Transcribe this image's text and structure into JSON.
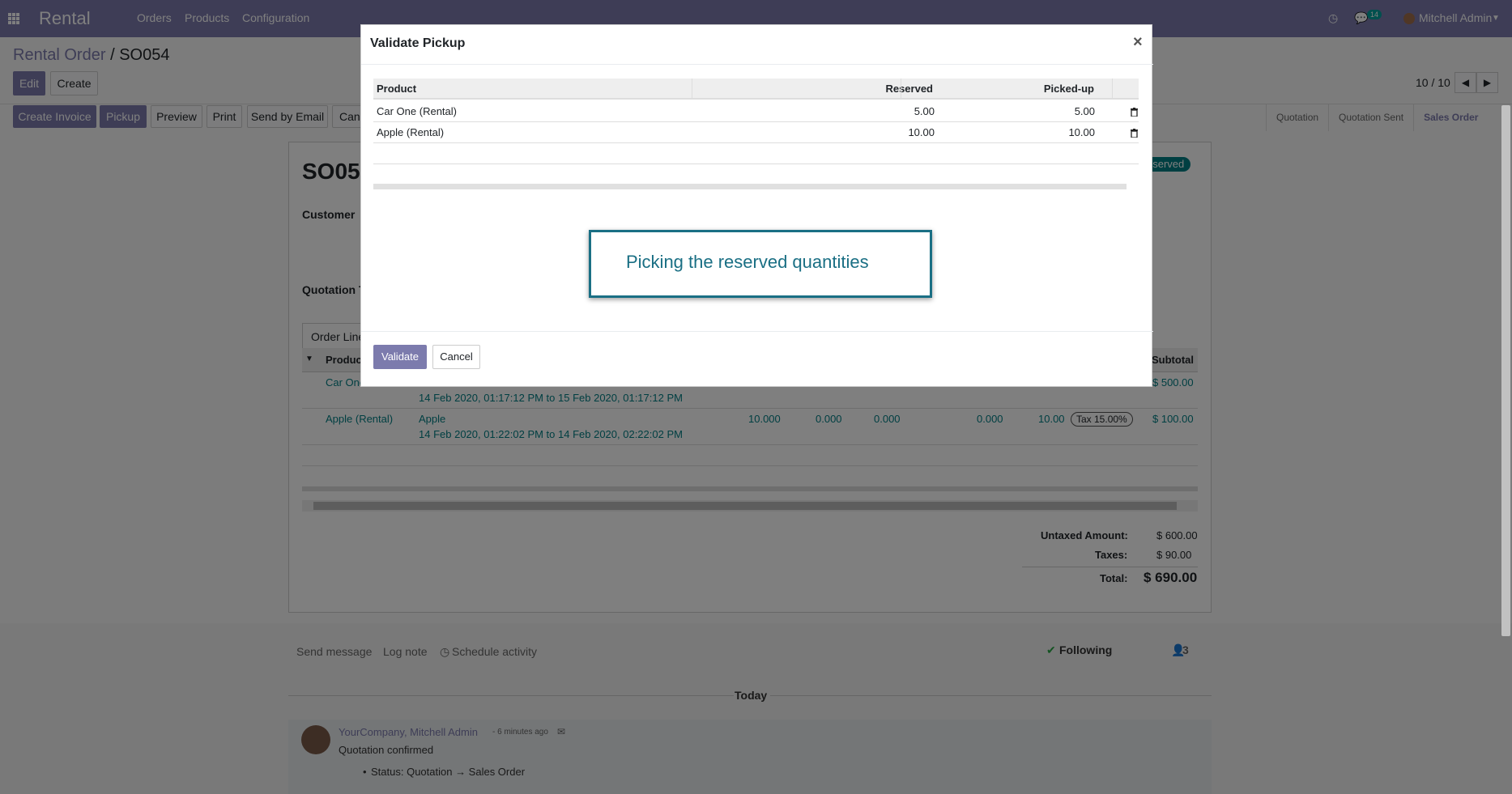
{
  "navbar": {
    "brand": "Rental",
    "menus": [
      "Orders",
      "Products",
      "Configuration"
    ],
    "notification_count": "14",
    "user": "Mitchell Admin"
  },
  "breadcrumb": {
    "parent": "Rental Order",
    "separator": "/",
    "current": "SO054"
  },
  "actions": {
    "edit": "Edit",
    "create": "Create"
  },
  "pager": {
    "text": "10 / 10"
  },
  "toolbar": {
    "create_invoice": "Create Invoice",
    "pickup": "Pickup",
    "preview": "Preview",
    "print": "Print",
    "send_email": "Send by Email",
    "cancel_partial": "Can"
  },
  "status_steps": [
    "Quotation",
    "Quotation Sent",
    "Sales Order"
  ],
  "form": {
    "title_partial": "SO054",
    "reserved_badge": "eserved",
    "customer_label": "Customer",
    "quotation_label_partial": "Quotation T",
    "tab_order_lines_partial": "Order Line",
    "col_product_partial": "Produc",
    "col_subtotal": "Subtotal",
    "lines": [
      {
        "product": "Car One",
        "dates": "14 Feb 2020, 01:17:12 PM to 15 Feb 2020, 01:17:12 PM",
        "subtotal": "$ 500.00"
      },
      {
        "product": "Apple (Rental)",
        "name": "Apple",
        "dates": "14 Feb 2020, 01:22:02 PM to 14 Feb 2020, 02:22:02 PM",
        "qty": "10.000",
        "picked": "0.000",
        "returned": "0.000",
        "discount": "0.000",
        "price": "10.00",
        "tax": "Tax 15.00%",
        "subtotal": "$ 100.00"
      }
    ],
    "totals": {
      "untaxed_label": "Untaxed Amount:",
      "untaxed": "$ 600.00",
      "taxes_label": "Taxes:",
      "taxes": "$ 90.00",
      "total_label": "Total:",
      "total": "$ 690.00"
    }
  },
  "chatter": {
    "send_message": "Send message",
    "log_note": "Log note",
    "schedule_activity": "Schedule activity",
    "following": "Following",
    "followers": "3",
    "today": "Today",
    "author": "YourCompany, Mitchell Admin",
    "time": "- 6 minutes ago",
    "message": "Quotation confirmed",
    "status_change": "Status: Quotation → Sales Order"
  },
  "modal": {
    "title": "Validate Pickup",
    "close": "×",
    "columns": {
      "product": "Product",
      "reserved": "Reserved",
      "picked": "Picked-up"
    },
    "rows": [
      {
        "product": "Car One (Rental)",
        "reserved": "5.00",
        "picked": "5.00"
      },
      {
        "product": "Apple (Rental)",
        "reserved": "10.00",
        "picked": "10.00"
      }
    ],
    "callout": "Picking the reserved quantities",
    "validate": "Validate",
    "cancel": "Cancel"
  },
  "colors": {
    "primary": "#7c7bad",
    "teal": "#017e84",
    "callout": "#1a6f84"
  }
}
